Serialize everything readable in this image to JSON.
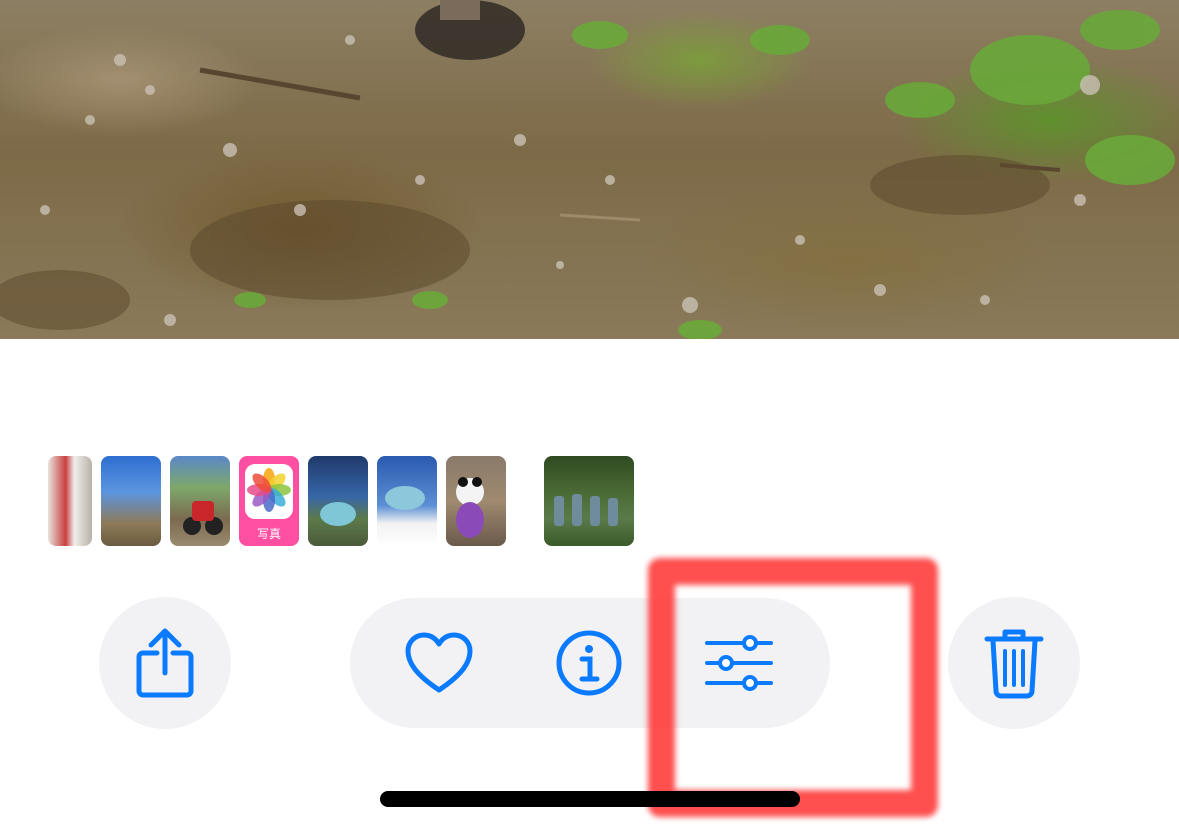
{
  "photo": {
    "description_icon": "main-photo"
  },
  "thumbnails": [
    {
      "id": "thumb-1",
      "color": "#d9d4cc"
    },
    {
      "id": "thumb-2",
      "color": "#3a78c8"
    },
    {
      "id": "thumb-3",
      "color": "#6b88b0"
    },
    {
      "id": "thumb-photos-app",
      "color": "#ff4fa3",
      "label": "写真"
    },
    {
      "id": "thumb-5",
      "color": "#2d4d7a"
    },
    {
      "id": "thumb-6",
      "color": "#3d6cb3"
    },
    {
      "id": "thumb-7",
      "color": "#8a6f5e"
    },
    {
      "id": "thumb-8",
      "color": "#3f5a2f"
    }
  ],
  "toolbar": {
    "share_icon": "share-icon",
    "favorite_icon": "heart-icon",
    "info_icon": "info-icon",
    "edit_icon": "sliders-icon",
    "delete_icon": "trash-icon",
    "accent_color": "#0a7aff"
  },
  "highlight": {
    "color": "#ff2828"
  }
}
